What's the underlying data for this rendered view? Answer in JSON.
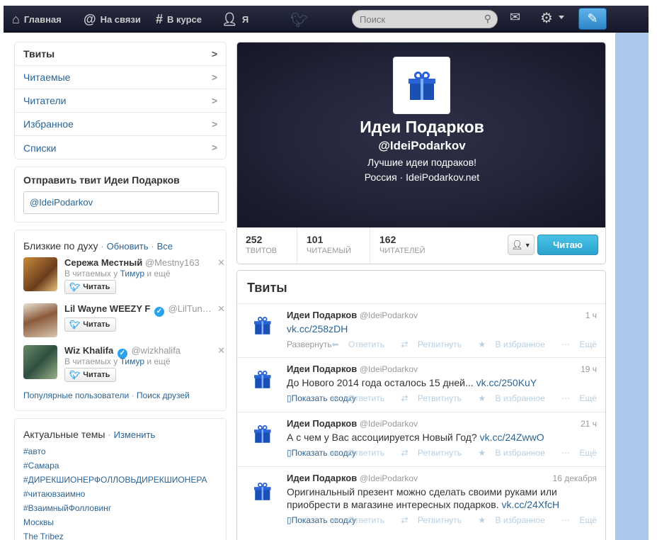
{
  "topnav": {
    "home": "Главная",
    "connect": "На связи",
    "discover": "В курсе",
    "me": "Я",
    "search_placeholder": "Поиск"
  },
  "sidebar_nav": [
    {
      "label": "Твиты"
    },
    {
      "label": "Читаемые"
    },
    {
      "label": "Читатели"
    },
    {
      "label": "Избранное"
    },
    {
      "label": "Списки"
    }
  ],
  "send_tweet": {
    "title": "Отправить твит Идеи Подарков",
    "value": "@IdeiPodarkov"
  },
  "who_to_follow": {
    "title": "Близкие по духу",
    "sep": "·",
    "refresh": "Обновить",
    "all": "Все",
    "follow_label": "Читать",
    "users": [
      {
        "name": "Сережа Местный",
        "handle": "@Mestny163",
        "verified": false,
        "sub_prefix": "В читаемых у",
        "sub_user": "Тимур",
        "sub_suffix": "и ещё"
      },
      {
        "name": "Lil Wayne WEEZY F",
        "handle": "@LilTun…",
        "verified": true,
        "sub_prefix": "",
        "sub_user": "",
        "sub_suffix": ""
      },
      {
        "name": "Wiz Khalifa",
        "handle": "@wizkhalifa",
        "verified": true,
        "sub_prefix": "В читаемых у",
        "sub_user": "Тимур",
        "sub_suffix": "и ещё"
      }
    ],
    "footer_popular": "Популярные пользователи",
    "footer_find": "Поиск друзей"
  },
  "trends": {
    "title": "Актуальные темы",
    "change": "Изменить",
    "items": [
      "#авто",
      "#Самара",
      "#ДИРЕКШИОНЕРФОЛЛОВЬДИРЕКШИОНЕРА",
      "#читаювзаимно",
      "#ВзаимныйФолловинг",
      "Москвы",
      "The Tribez"
    ]
  },
  "profile": {
    "name": "Идеи Подарков",
    "handle": "@IdeiPodarkov",
    "bio": "Лучшие идеи подраков!",
    "location": "Россия",
    "dot": "·",
    "website": "IdeiPodarkov.net",
    "stats": [
      {
        "num": "252",
        "label": "ТВИТОВ"
      },
      {
        "num": "101",
        "label": "ЧИТАЕМЫЙ"
      },
      {
        "num": "162",
        "label": "ЧИТАТЕЛЕЙ"
      }
    ],
    "follow_button": "Читаю"
  },
  "tweets": {
    "title": "Твиты",
    "actions": {
      "reply": "Ответить",
      "retweet": "Ретвитнуть",
      "favorite": "В избранное",
      "more": "Ещё"
    },
    "items": [
      {
        "name": "Идеи Подарков",
        "handle": "@IdeiPodarkov",
        "time": "1 ч",
        "text": "",
        "link": "vk.cc/258zDH",
        "expand": "Развернуть"
      },
      {
        "name": "Идеи Подарков",
        "handle": "@IdeiPodarkov",
        "time": "19 ч",
        "text": "До Нового 2014 года осталось 15 дней...",
        "link": "vk.cc/250KuY",
        "expand": "Показать сводку"
      },
      {
        "name": "Идеи Подарков",
        "handle": "@IdeiPodarkov",
        "time": "21 ч",
        "text": "А с чем у Вас ассоциируется Новый Год?",
        "link": "vk.cc/24ZwwO",
        "expand": "Показать сводку"
      },
      {
        "name": "Идеи Подарков",
        "handle": "@IdeiPodarkov",
        "time": "16 декабря",
        "text": "Оригинальный презент можно сделать своими руками или приобрести в магазине интересных подарков.",
        "link": "vk.cc/24XfcH",
        "expand": "Показать сводку"
      }
    ]
  },
  "colors": {
    "topbar": "#1e2033",
    "link": "#2a6496",
    "follow_button": "#2aa3cf",
    "right_background": "#a9c8ec"
  }
}
